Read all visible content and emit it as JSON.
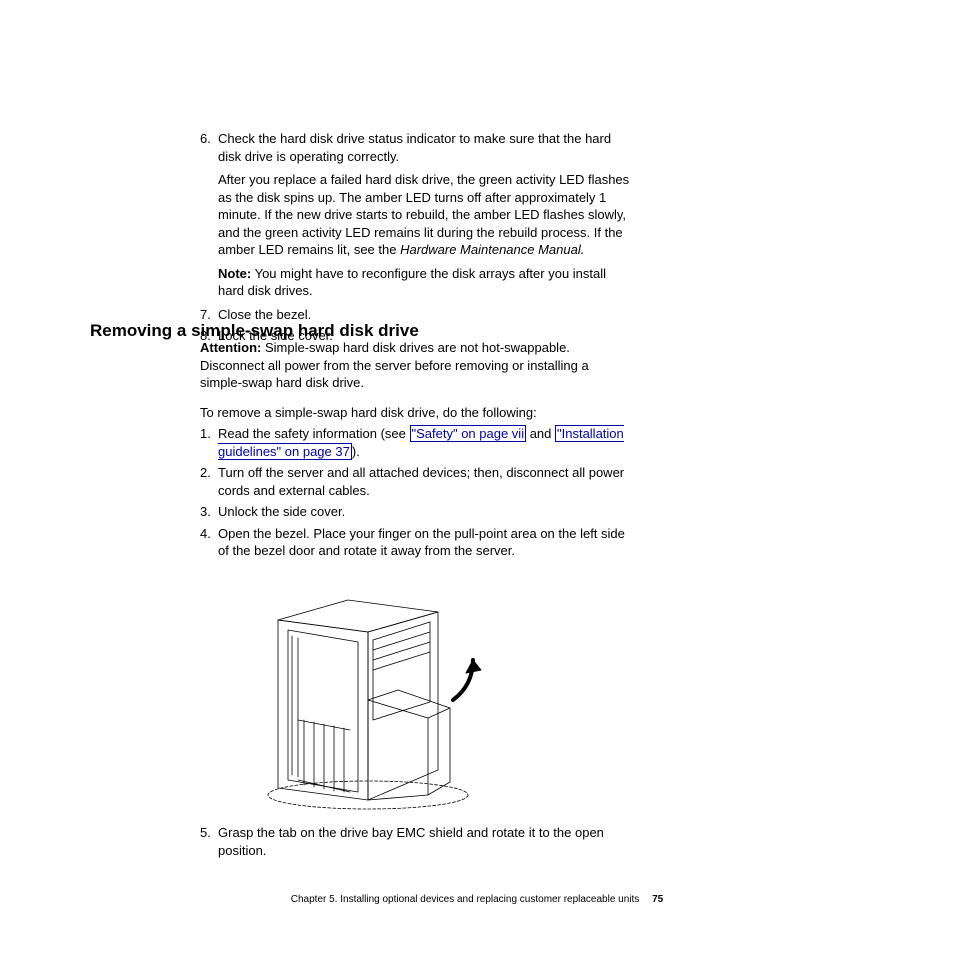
{
  "prior_steps": {
    "s6_num": "6.",
    "s6_text": "Check the hard disk drive status indicator to make sure that the hard disk drive is operating correctly.",
    "s6_after": "After you replace a failed hard disk drive, the green activity LED flashes as the disk spins up. The amber LED turns off after approximately 1 minute. If the new drive starts to rebuild, the amber LED flashes slowly, and the green activity LED remains lit during the rebuild process. If the amber LED remains lit, see the ",
    "s6_after_italic": "Hardware Maintenance Manual.",
    "note_label": "Note:",
    "note_text": "  You might have to reconfigure the disk arrays after you install hard disk drives.",
    "s7_num": "7.",
    "s7_text": "Close the bezel.",
    "s8_num": "8.",
    "s8_text": "Lock the side cover."
  },
  "section": {
    "heading": "Removing a simple-swap hard disk drive",
    "attention_label": "Attention:",
    "attention_text": "   Simple-swap hard disk drives are not hot-swappable. Disconnect all power from the server before removing or installing a simple-swap hard disk drive.",
    "intro": "To remove a simple-swap hard disk drive, do the following:",
    "s1_num": "1.",
    "s1_pre": " Read the safety information (see ",
    "s1_link1": "\"Safety\" on page vii",
    "s1_mid": " and ",
    "s1_link2": "\"Installation guidelines\" on page 37",
    "s1_post": ").",
    "s2_num": "2.",
    "s2_text": "Turn off the server and all attached devices; then, disconnect all power cords and external cables.",
    "s3_num": "3.",
    "s3_text": "Unlock the side cover.",
    "s4_num": "4.",
    "s4_text": "Open the bezel. Place your finger on the pull-point area on the left side of the bezel door and rotate it away from the server.",
    "s5_num": "5.",
    "s5_text": "Grasp the tab on the drive bay EMC shield and rotate it to the open position."
  },
  "footer": {
    "chapter": "Chapter 5. Installing optional devices and replacing customer replaceable units",
    "page_number": "75"
  }
}
